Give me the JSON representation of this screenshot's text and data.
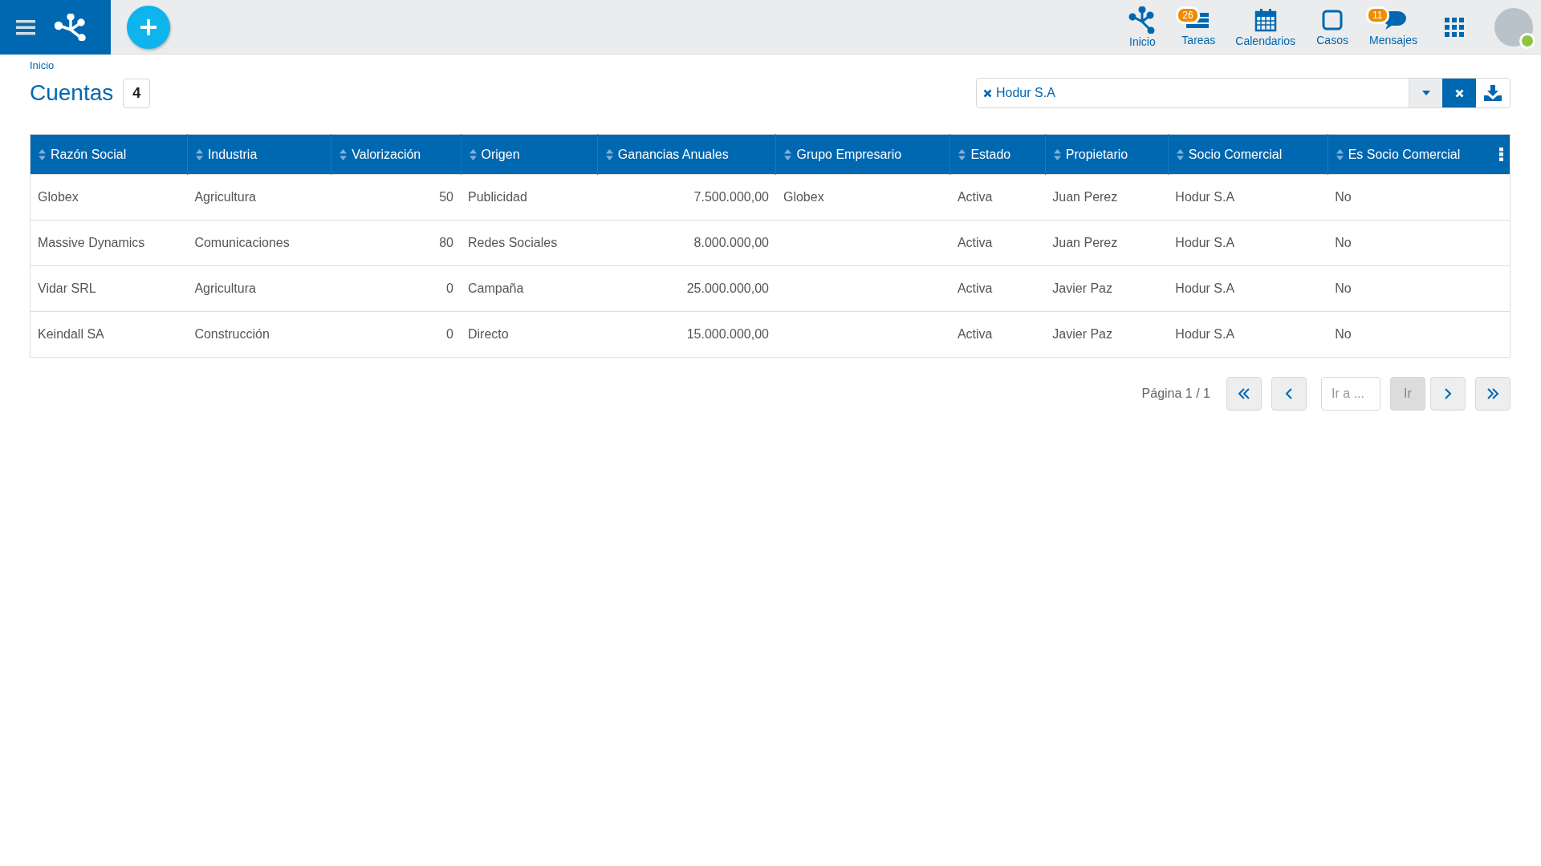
{
  "top_bar": {
    "nav": [
      {
        "kind": "home",
        "label": "Inicio"
      },
      {
        "kind": "tasks",
        "label": "Tareas",
        "badge": "26"
      },
      {
        "kind": "calendar",
        "label": "Calendarios"
      },
      {
        "kind": "cases",
        "label": "Casos"
      },
      {
        "kind": "messages",
        "label": "Mensajes",
        "badge": "11"
      }
    ]
  },
  "breadcrumb": "Inicio",
  "title": "Cuentas",
  "count": "4",
  "filter": {
    "tag": "Hodur S.A"
  },
  "table": {
    "columns": [
      {
        "label": "Razón Social",
        "kind": "text"
      },
      {
        "label": "Industria",
        "kind": "text"
      },
      {
        "label": "Valorización",
        "kind": "number"
      },
      {
        "label": "Origen",
        "kind": "text"
      },
      {
        "label": "Ganancias Anuales",
        "kind": "number"
      },
      {
        "label": "Grupo Empresario",
        "kind": "text"
      },
      {
        "label": "Estado",
        "kind": "text"
      },
      {
        "label": "Propietario",
        "kind": "text"
      },
      {
        "label": "Socio Comercial",
        "kind": "text"
      },
      {
        "label": "Es Socio Comercial",
        "kind": "text"
      }
    ],
    "rows": [
      [
        "Globex",
        "Agricultura",
        "50",
        "Publicidad",
        "7.500.000,00",
        "Globex",
        "Activa",
        "Juan Perez",
        "Hodur S.A",
        "No"
      ],
      [
        "Massive Dynamics",
        "Comunicaciones",
        "80",
        "Redes Sociales",
        "8.000.000,00",
        "",
        "Activa",
        "Juan Perez",
        "Hodur S.A",
        "No"
      ],
      [
        "Vidar SRL",
        "Agricultura",
        "0",
        "Campaña",
        "25.000.000,00",
        "",
        "Activa",
        "Javier Paz",
        "Hodur S.A",
        "No"
      ],
      [
        "Keindall SA",
        "Construcción",
        "0",
        "Directo",
        "15.000.000,00",
        "",
        "Activa",
        "Javier Paz",
        "Hodur S.A",
        "No"
      ]
    ]
  },
  "pager": {
    "label": "Página 1 / 1",
    "goto_placeholder": "Ir a ...",
    "go_label": "Ir",
    "go_disabled": true
  }
}
